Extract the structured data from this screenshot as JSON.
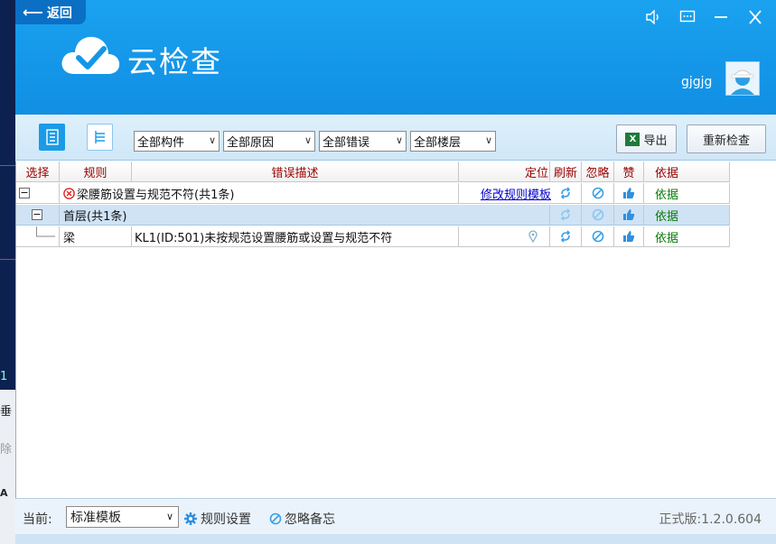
{
  "window": {
    "back_label": "返回",
    "title": "云检查",
    "user_name": "gjgjg"
  },
  "background_fragments": [
    "1",
    "垂",
    "除",
    "A"
  ],
  "toolbar": {
    "filters": [
      {
        "value": "全部构件"
      },
      {
        "value": "全部原因"
      },
      {
        "value": "全部错误"
      },
      {
        "value": "全部楼层"
      }
    ],
    "export_label": "导出",
    "export_icon_text": "X",
    "recheck_label": "重新检查"
  },
  "grid": {
    "headers": [
      "选择",
      "规则",
      "错误描述",
      "定位",
      "刷新",
      "忽略",
      "赞",
      "依据"
    ],
    "group": {
      "toggle": "−",
      "title": "梁腰筋设置与规范不符(共1条)",
      "link": "修改规则模板",
      "basis": "依据"
    },
    "floor": {
      "toggle": "−",
      "title": "首层(共1条)",
      "basis": "依据"
    },
    "item": {
      "rule": "梁",
      "description": "KL1(ID:501)未按规范设置腰筋或设置与规范不符",
      "basis": "依据"
    }
  },
  "statusbar": {
    "current_label": "当前:",
    "template_value": "标准模板",
    "rule_settings": "规则设置",
    "ignore_notes": "忽略备忘",
    "version": "正式版:1.2.0.604"
  },
  "colors": {
    "header_blue": "#1496e8",
    "error_red": "#e02424",
    "basis_green": "#0a7a0a",
    "link_blue": "#0000cc"
  }
}
